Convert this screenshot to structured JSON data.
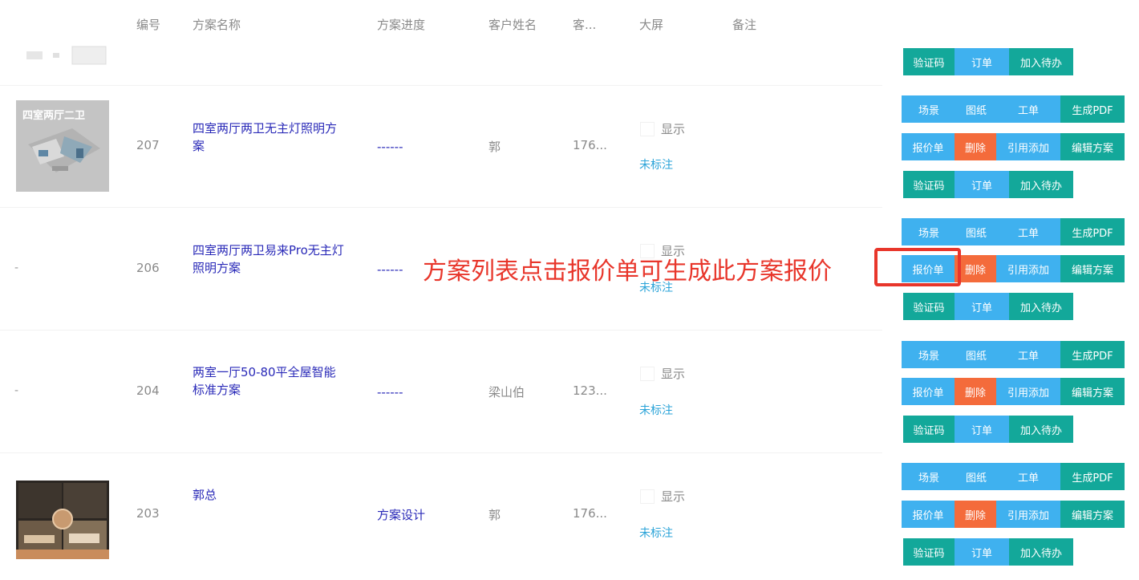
{
  "header": {
    "col_id": "编号",
    "col_name": "方案名称",
    "col_progress": "方案进度",
    "col_customer": "客户姓名",
    "col_phone": "客...",
    "col_screen": "大屏",
    "col_note": "备注"
  },
  "top_partial_buttons": {
    "verify": "验证码",
    "order": "订单",
    "todo": "加入待办"
  },
  "annotation": "方案列表点击报价单可生成此方案报价",
  "rows": [
    {
      "thumb_text": "四室两厅二卫",
      "id": "207",
      "name": "四室两厅两卫无主灯照明方案",
      "progress": "------",
      "customer": "郭",
      "phone": "176...",
      "show": "显示",
      "mark": "未标注",
      "buttons": {
        "scene": "场景",
        "drawing": "图纸",
        "work": "工单",
        "pdf": "生成PDF",
        "quote": "报价单",
        "delete": "删除",
        "ref": "引用添加",
        "edit": "编辑方案",
        "verify": "验证码",
        "order": "订单",
        "todo": "加入待办"
      }
    },
    {
      "thumb_text": "-",
      "id": "206",
      "name": "四室两厅两卫易来Pro无主灯照明方案",
      "progress": "------",
      "customer": "",
      "phone": "",
      "show": "显示",
      "mark": "未标注",
      "buttons": {
        "scene": "场景",
        "drawing": "图纸",
        "work": "工单",
        "pdf": "生成PDF",
        "quote": "报价单",
        "delete": "删除",
        "ref": "引用添加",
        "edit": "编辑方案",
        "verify": "验证码",
        "order": "订单",
        "todo": "加入待办"
      }
    },
    {
      "thumb_text": "-",
      "id": "204",
      "name": "两室一厅50-80平全屋智能标准方案",
      "progress": "------",
      "customer": "梁山伯",
      "phone": "123...",
      "show": "显示",
      "mark": "未标注",
      "buttons": {
        "scene": "场景",
        "drawing": "图纸",
        "work": "工单",
        "pdf": "生成PDF",
        "quote": "报价单",
        "delete": "删除",
        "ref": "引用添加",
        "edit": "编辑方案",
        "verify": "验证码",
        "order": "订单",
        "todo": "加入待办"
      }
    },
    {
      "thumb_text": "",
      "id": "203",
      "name": "郭总",
      "progress": "方案设计",
      "customer": "郭",
      "phone": "176...",
      "show": "显示",
      "mark": "未标注",
      "buttons": {
        "scene": "场景",
        "drawing": "图纸",
        "work": "工单",
        "pdf": "生成PDF",
        "quote": "报价单",
        "delete": "删除",
        "ref": "引用添加",
        "edit": "编辑方案",
        "verify": "验证码",
        "order": "订单",
        "todo": "加入待办"
      }
    }
  ],
  "colors": {
    "blue_button": "#3fb1ef",
    "green_button": "#13a89a",
    "orange_button": "#f46b3b",
    "link": "#2a2ab8",
    "annotation": "#e8362b",
    "mark": "#2aa3d8"
  }
}
